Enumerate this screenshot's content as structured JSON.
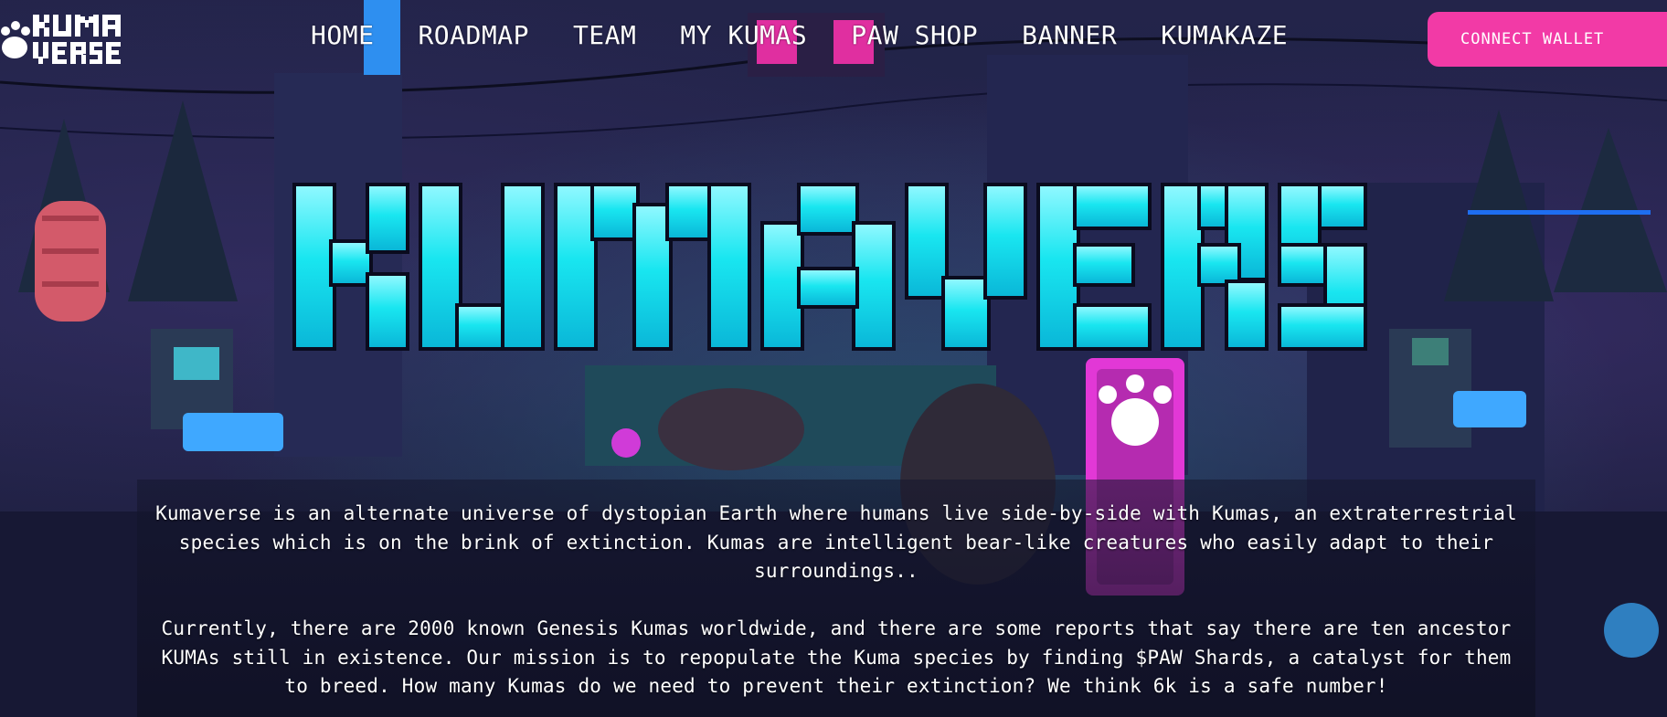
{
  "brand": {
    "name": "Kumaverse",
    "logo_icon": "paw-icon"
  },
  "nav": {
    "items": [
      {
        "label": "HOME"
      },
      {
        "label": "ROADMAP"
      },
      {
        "label": "TEAM"
      },
      {
        "label": "MY KUMAS"
      },
      {
        "label": "PAW SHOP"
      },
      {
        "label": "BANNER"
      },
      {
        "label": "KUMAKAZE"
      }
    ],
    "wallet_button": "CONNECT WALLET"
  },
  "hero": {
    "title": "KUMAVERSE",
    "paragraphs": [
      "Kumaverse is an alternate universe of dystopian Earth where humans live side-by-side with Kumas, an extraterrestrial species which is on the brink of extinction. Kumas are intelligent bear-like creatures who easily adapt to their surroundings..",
      "Currently, there are 2000 known Genesis Kumas worldwide, and there are some reports that say there are ten ancestor KUMAs still in existence. Our mission is to repopulate the Kuma species by finding $PAW Shards, a catalyst for them to breed. How many Kumas do we need to prevent their extinction? We think 6k is a safe number!"
    ]
  },
  "colors": {
    "accent_pink": "#f23aa6",
    "title_cyan": "#19e6f0",
    "background": "#1b1c3a"
  }
}
